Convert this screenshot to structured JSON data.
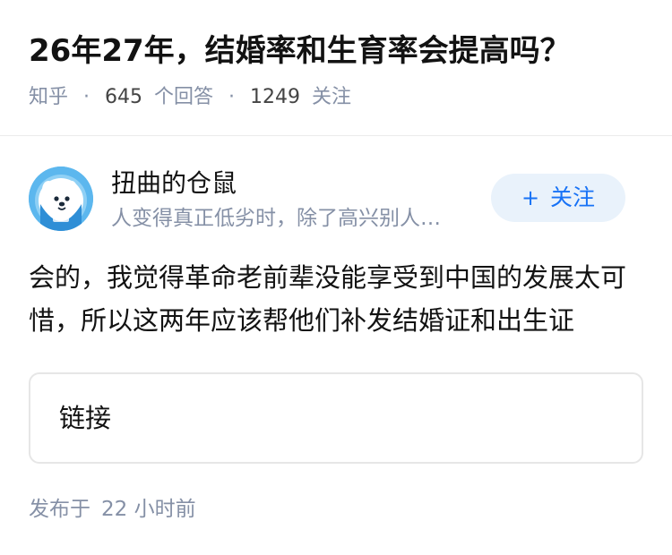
{
  "question": {
    "title": "26年27年，结婚率和生育率会提高吗？",
    "source": "知乎",
    "separator": "·",
    "answers_count": "645",
    "answers_label": "个回答",
    "follows_count": "1249",
    "follows_label": "关注"
  },
  "author": {
    "avatar_icon": "cartoon-dog-avatar",
    "avatar_color": "#5cb7ee",
    "name": "扭曲的仓鼠",
    "bio": "人变得真正低劣时，除了高兴别人…",
    "follow_plus": "+",
    "follow_label": "关注"
  },
  "answer": {
    "content": "会的，我觉得革命老前辈没能享受到中国的发展太可惜，所以这两年应该帮他们补发结婚证和出生证"
  },
  "link_card": {
    "label": "链接"
  },
  "publish": {
    "label": "发布于",
    "time": "22 小时前"
  },
  "colors": {
    "accent": "#1772f6",
    "follow_bg": "#e9f2fb",
    "meta_text": "#8590a6",
    "primary_text": "#121212"
  }
}
